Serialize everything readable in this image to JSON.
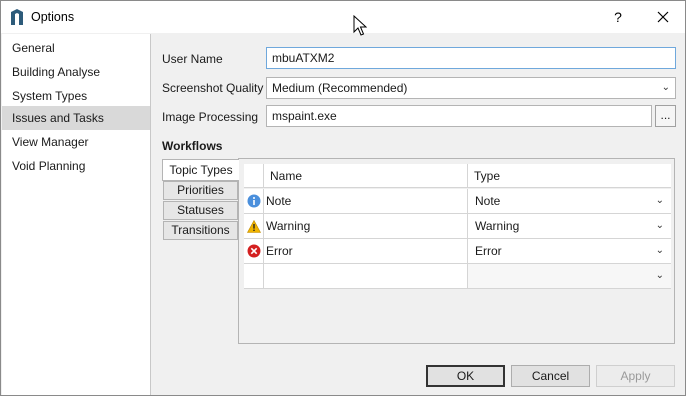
{
  "window": {
    "title": "Options",
    "help_glyph": "?"
  },
  "sidebar": {
    "items": [
      {
        "label": "General"
      },
      {
        "label": "Building Analyse"
      },
      {
        "label": "System Types"
      },
      {
        "label": "Issues and Tasks",
        "selected": true
      },
      {
        "label": "View Manager"
      },
      {
        "label": "Void Planning"
      }
    ]
  },
  "form": {
    "user_name_label": "User Name",
    "user_name_value": "mbuATXM2",
    "screenshot_quality_label": "Screenshot Quality",
    "screenshot_quality_value": "Medium (Recommended)",
    "image_processing_label": "Image Processing",
    "image_processing_value": "mspaint.exe",
    "browse_label": "..."
  },
  "workflows": {
    "heading": "Workflows",
    "tabs": [
      {
        "label": "Topic Types",
        "active": true
      },
      {
        "label": "Priorities"
      },
      {
        "label": "Statuses"
      },
      {
        "label": "Transitions"
      }
    ],
    "grid": {
      "columns": {
        "name": "Name",
        "type": "Type"
      },
      "rows": [
        {
          "icon": "info-icon",
          "name": "Note",
          "type": "Note"
        },
        {
          "icon": "warning-icon",
          "name": "Warning",
          "type": "Warning"
        },
        {
          "icon": "error-icon",
          "name": "Error",
          "type": "Error"
        },
        {
          "icon": "",
          "name": "",
          "type": ""
        }
      ]
    }
  },
  "footer": {
    "ok": "OK",
    "cancel": "Cancel",
    "apply": "Apply"
  },
  "colors": {
    "selection": "#d9d9d9",
    "info": "#4a8fdc",
    "warning": "#f0b400",
    "error": "#d42020",
    "focus_border": "#6fa8dc"
  }
}
